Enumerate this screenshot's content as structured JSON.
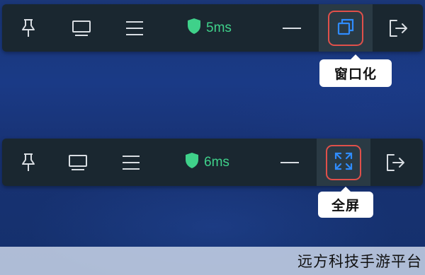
{
  "toolbars": [
    {
      "pin_icon": "pin-icon",
      "monitor_icon": "monitor-icon",
      "menu_icon": "hamburger-menu-icon",
      "shield_icon": "shield-icon",
      "latency": "5ms",
      "minimize_icon": "minimize-icon",
      "window_mode_icon": "window-restore-icon",
      "exit_icon": "exit-icon",
      "tooltip": "窗口化"
    },
    {
      "pin_icon": "pin-icon",
      "monitor_icon": "monitor-icon",
      "menu_icon": "hamburger-menu-icon",
      "shield_icon": "shield-icon",
      "latency": "6ms",
      "minimize_icon": "minimize-icon",
      "fullscreen_icon": "fullscreen-expand-icon",
      "exit_icon": "exit-icon",
      "tooltip": "全屏"
    }
  ],
  "colors": {
    "toolbar_bg": "#1a2730",
    "icon": "#d8dde2",
    "latency_green": "#3fd18a",
    "highlight_ring": "#e0504a",
    "active_icon_blue": "#2f8cff"
  },
  "watermark": "远方科技手游平台"
}
